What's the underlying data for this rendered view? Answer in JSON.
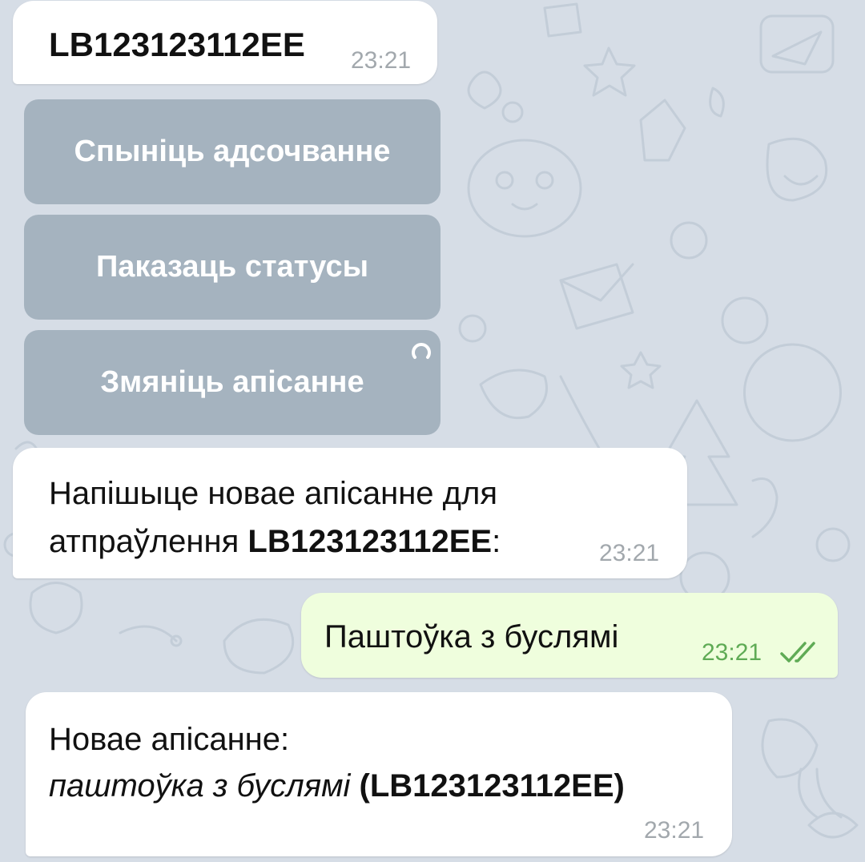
{
  "messages": {
    "m1": {
      "text": "LB123123112EE",
      "time": "23:21"
    },
    "m2": {
      "line1": "Напішыце новае апісанне для",
      "line2_prefix": "атпраўлення ",
      "code": "LB123123112EE",
      "colon": ":",
      "time": "23:21"
    },
    "m3": {
      "text": "Паштоўка з буслямі",
      "time": "23:21"
    },
    "m4": {
      "line1": "Новае апісанне:",
      "desc": "паштоўка з буслямі",
      "code": "(LB123123112EE)",
      "time": "23:21"
    }
  },
  "keyboard": {
    "buttons": [
      "Спыніць адсочванне",
      "Паказаць статусы",
      "Змяніць апісанне"
    ]
  },
  "icons": {
    "loading": "loading-spinner-icon",
    "read_status": "double-check-icon"
  },
  "colors": {
    "wallpaper": "#d6dde6",
    "incoming_bubble": "#ffffff",
    "outgoing_bubble": "#effedd",
    "outgoing_time": "#5fab55",
    "keyboard_button": "#a5b1bc"
  }
}
